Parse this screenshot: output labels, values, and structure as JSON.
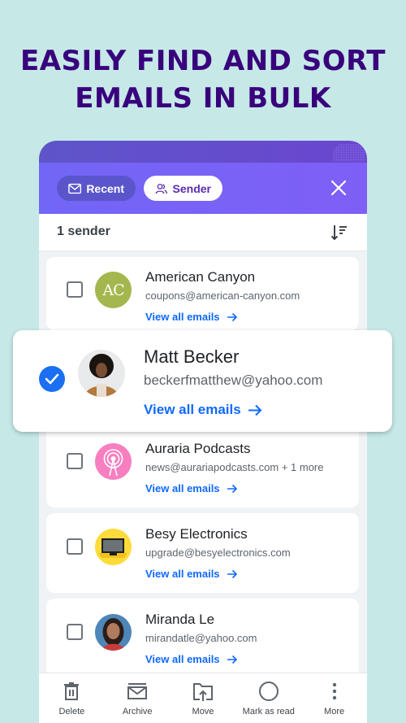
{
  "headline": {
    "line1": "EASILY FIND AND SORT",
    "line2": "EMAILS IN BULK"
  },
  "tabs": {
    "recent": {
      "label": "Recent",
      "icon": "envelope-icon",
      "active": false
    },
    "sender": {
      "label": "Sender",
      "icon": "people-icon",
      "active": true
    },
    "close_icon": "close-icon"
  },
  "list_header": {
    "count_label": "1 sender",
    "sort_icon": "sort-descending-icon"
  },
  "senders": [
    {
      "name": "American Canyon",
      "email": "coupons@american-canyon.com",
      "link": "View all emails",
      "avatar": "AC",
      "avatar_color": "#a3b74e",
      "selected": false
    },
    {
      "name": "Matt Becker",
      "email": "beckerfmatthew@yahoo.com",
      "link": "View all emails",
      "avatar": "photo",
      "selected": true
    },
    {
      "name": "Auraria Podcasts",
      "email": "news@aurariapodcasts.com + 1 more",
      "link": "View all emails",
      "avatar": "broadcast-icon",
      "avatar_color": "#f77fc0",
      "selected": false
    },
    {
      "name": "Besy Electronics",
      "email": "upgrade@besyelectronics.com",
      "link": "View all emails",
      "avatar": "tv-icon",
      "avatar_color": "#fddb3a",
      "selected": false
    },
    {
      "name": "Miranda Le",
      "email": "mirandatle@yahoo.com",
      "link": "View all emails",
      "avatar": "photo",
      "selected": false
    }
  ],
  "toolbar": [
    {
      "label": "Delete",
      "icon": "trash-icon"
    },
    {
      "label": "Archive",
      "icon": "archive-icon"
    },
    {
      "label": "Move",
      "icon": "move-folder-icon"
    },
    {
      "label": "Mark as read",
      "icon": "circle-icon"
    },
    {
      "label": "More",
      "icon": "more-vertical-icon"
    }
  ],
  "colors": {
    "background": "#c6e9e8",
    "headline": "#39007c",
    "accent": "#7266f6",
    "link": "#0f69ff",
    "check": "#1a6ff2"
  }
}
